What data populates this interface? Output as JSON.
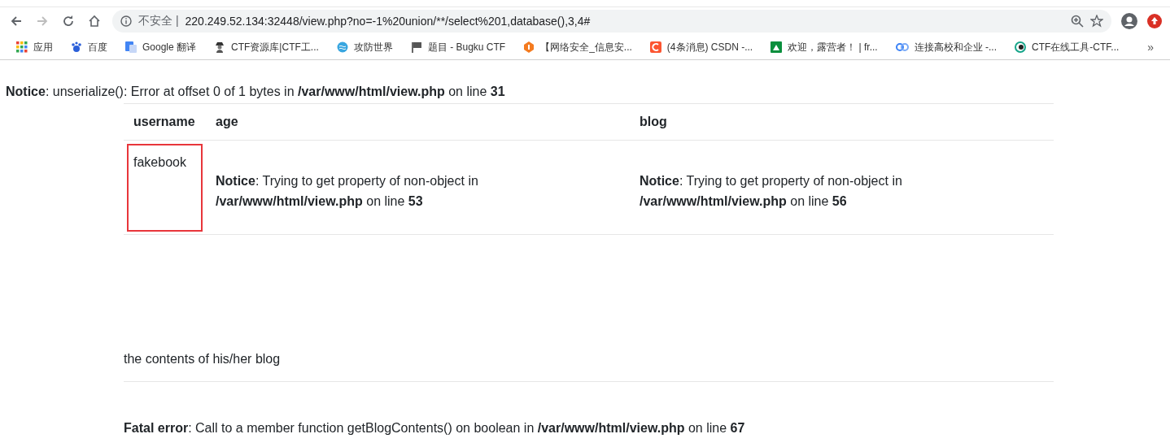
{
  "toolbar": {
    "security_label": "不安全 |",
    "url": "220.249.52.134:32448/view.php?no=-1%20union/**/select%201,database(),3,4#"
  },
  "bookmarks": [
    {
      "label": "应用"
    },
    {
      "label": "百度"
    },
    {
      "label": "Google 翻译"
    },
    {
      "label": "CTF资源库|CTF工..."
    },
    {
      "label": "攻防世界"
    },
    {
      "label": "题目 - Bugku CTF"
    },
    {
      "label": "【网络安全_信息安..."
    },
    {
      "label": "(4条消息) CSDN -..."
    },
    {
      "label": "欢迎，露营者！ | fr..."
    },
    {
      "label": "连接高校和企业 -..."
    },
    {
      "label": "CTF在线工具-CTF..."
    }
  ],
  "bookmarks_more": "»",
  "notice": "**Notice**: unserialize(): Error at offset 0 of 1 bytes in **/var/www/html/view.php** on line **31**",
  "table": {
    "columns": [
      "username",
      "age",
      "blog"
    ],
    "rows": [
      {
        "cells": [
          {
            "text": "fakebook",
            "highlighted": true
          },
          {
            "text": "**Notice**: Trying to get property of non-object in **/var/www/html/view.php** on line **53**",
            "highlighted": false
          },
          {
            "text": "**Notice**: Trying to get property of non-object in **/var/www/html/view.php** on line **56**",
            "highlighted": false
          }
        ]
      }
    ]
  },
  "blog_contents": "the contents of his/her blog",
  "fatal_error": "**Fatal error**: Call to a member function getBlogContents() on boolean in **/var/www/html/view.php** on line **67**"
}
